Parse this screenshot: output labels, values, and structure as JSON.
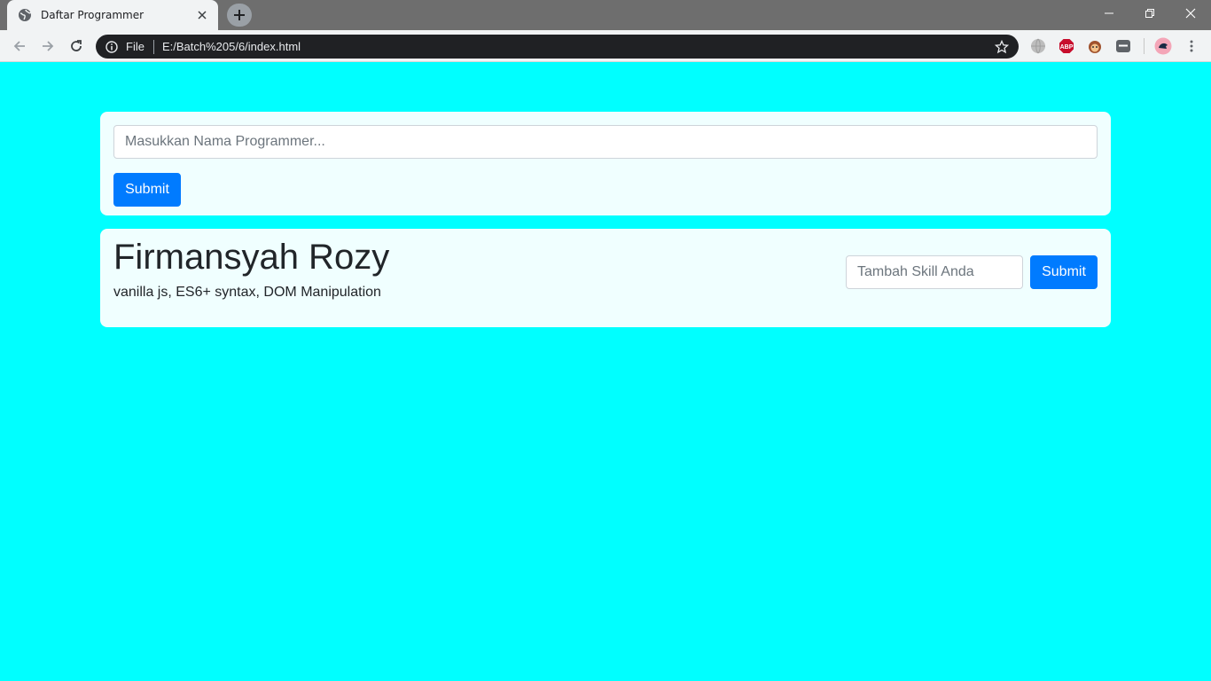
{
  "browser": {
    "tab_title": "Daftar Programmer",
    "scheme_label": "File",
    "url": "E:/Batch%205/6/index.html",
    "extensions": [
      "globe-icon",
      "adblock-icon",
      "monkey-icon",
      "chat-icon",
      "profile-avatar"
    ],
    "ext_labels": {
      "adblock": "ABP"
    }
  },
  "form": {
    "name_placeholder": "Masukkan Nama Programmer...",
    "submit_label": "Submit"
  },
  "programmer": {
    "name": "Firmansyah Rozy",
    "skills": "vanilla js, ES6+ syntax, DOM Manipulation",
    "skill_placeholder": "Tambah Skill Anda",
    "submit_label": "Submit"
  },
  "colors": {
    "page_background": "#00ffff",
    "card_background": "#f0ffff",
    "primary_button": "#007bff"
  }
}
